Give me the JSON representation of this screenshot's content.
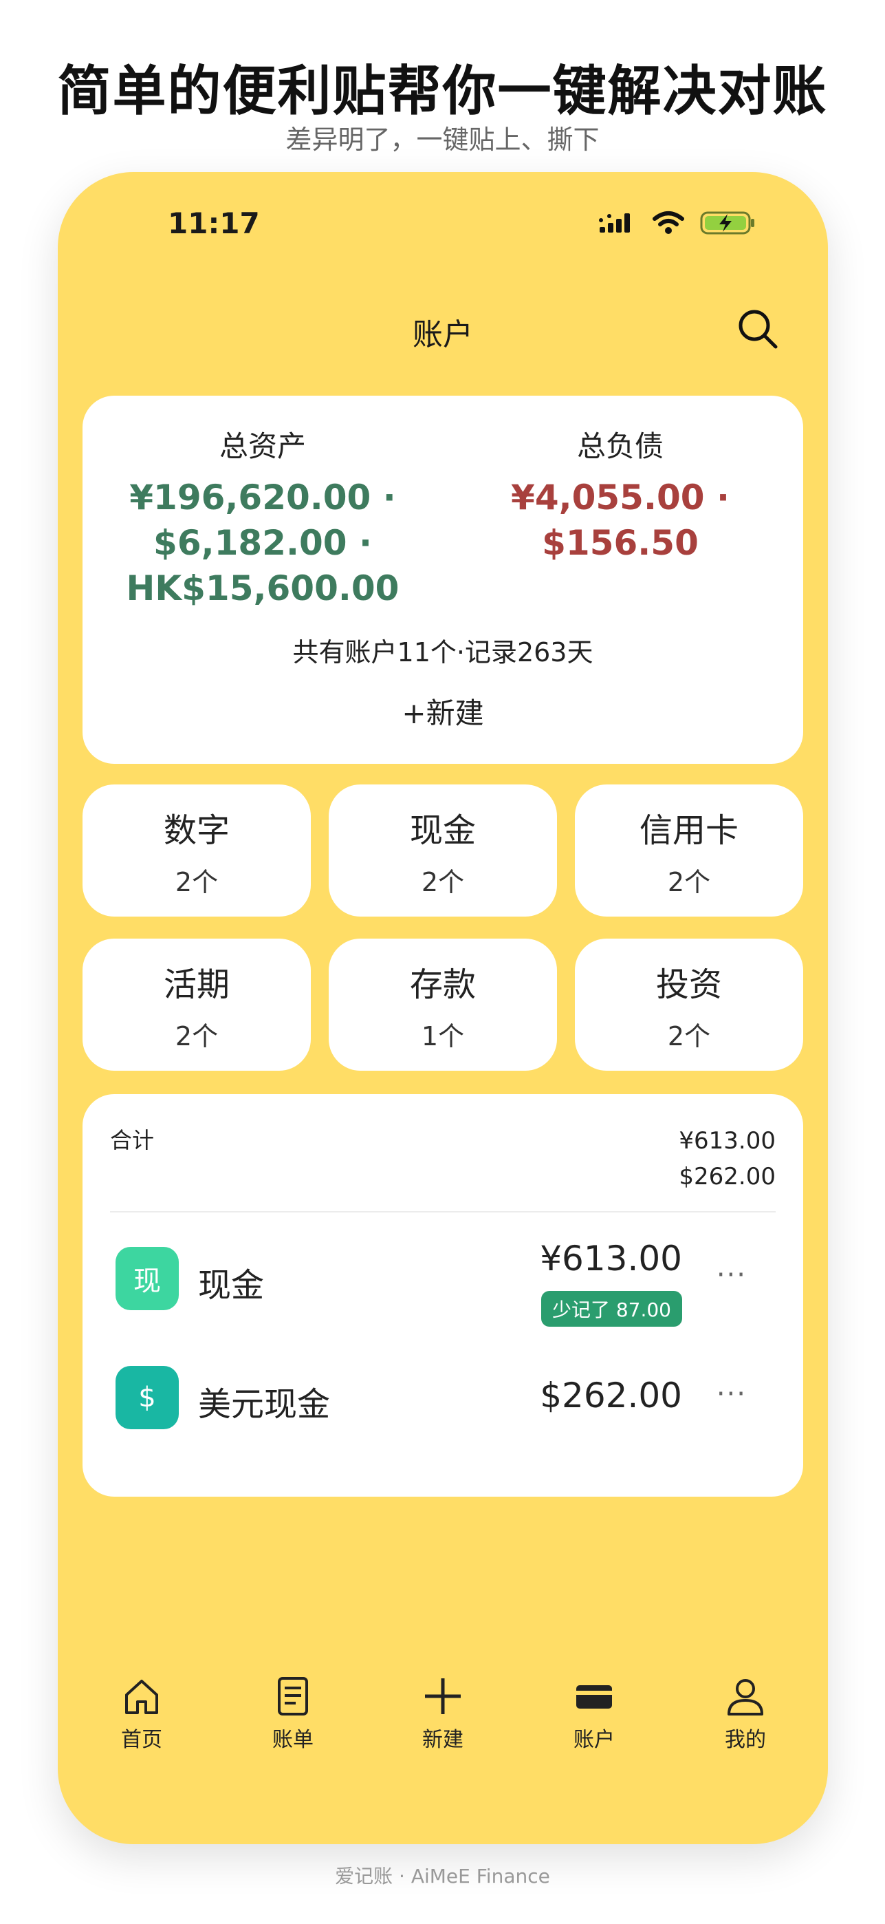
{
  "promo": {
    "headline": "简单的便利贴帮你一键解决对账",
    "subline": "差异明了，一键贴上、撕下"
  },
  "status_bar": {
    "time": "11:17"
  },
  "nav": {
    "title": "账户"
  },
  "summary": {
    "assets_title": "总资产",
    "assets_line1": "¥196,620.00 ·",
    "assets_line2": "$6,182.00 ·",
    "assets_line3": "HK$15,600.00",
    "liabilities_title": "总负债",
    "liabilities_line1": "¥4,055.00 ·",
    "liabilities_line2": "$156.50",
    "stats": "共有账户11个·记录263天",
    "new_label": "+新建"
  },
  "categories": [
    {
      "name": "数字",
      "count": "2个"
    },
    {
      "name": "现金",
      "count": "2个"
    },
    {
      "name": "信用卡",
      "count": "2个"
    },
    {
      "name": "活期",
      "count": "2个"
    },
    {
      "name": "存款",
      "count": "1个"
    },
    {
      "name": "投资",
      "count": "2个"
    }
  ],
  "account_list": {
    "total_label": "合计",
    "total_cny": "¥613.00",
    "total_usd": "$262.00",
    "rows": [
      {
        "icon_text": "现",
        "name": "现金",
        "amount": "¥613.00",
        "badge": "少记了 87.00",
        "more": "···"
      },
      {
        "icon_text": "$",
        "name": "美元现金",
        "amount": "$262.00",
        "more": "···"
      }
    ]
  },
  "tabbar": {
    "home": "首页",
    "bills": "账单",
    "new": "新建",
    "accounts": "账户",
    "me": "我的"
  },
  "footer": "爱记账 ·   AiMeE Finance",
  "colors": {
    "background": "#FFDD66",
    "asset_green": "#3E7B5E",
    "liability_red": "#A8403D",
    "badge_green": "#2A9D6E",
    "cash_icon": "#3DD6A0",
    "usd_icon": "#19B7A3"
  }
}
